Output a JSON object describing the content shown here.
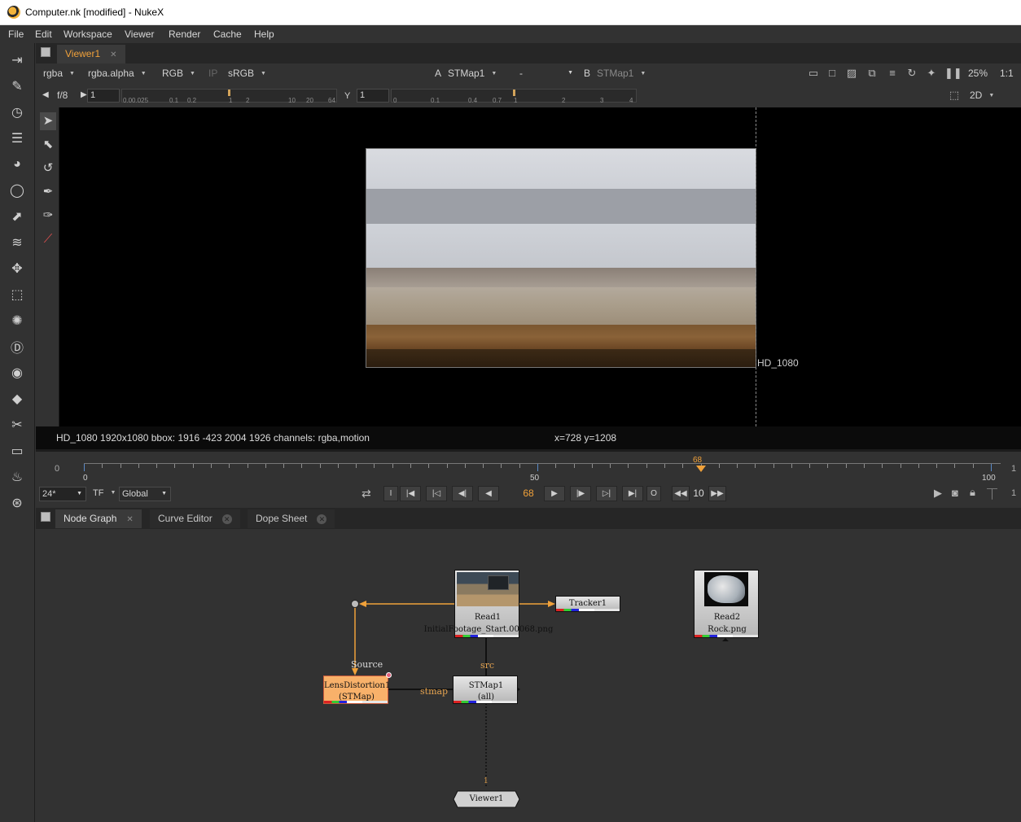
{
  "window": {
    "title": "Computer.nk [modified] - NukeX"
  },
  "menu": [
    "File",
    "Edit",
    "Workspace",
    "Viewer",
    "Render",
    "Cache",
    "Help"
  ],
  "viewer": {
    "tab": "Viewer1",
    "channels": "rgba",
    "alpha_channel": "rgba.alpha",
    "display_channels": "RGB",
    "ip": "IP",
    "lut": "sRGB",
    "input_a_label": "A",
    "input_a": "STMap1",
    "compare_mode": "-",
    "input_b_label": "B",
    "input_b": "STMap1",
    "zoom": "25%",
    "proxy": "1:1",
    "fstop": "f/8",
    "gain": "1",
    "gamma_label": "Y",
    "gamma": "1",
    "view_mode": "2D",
    "gain_ticks": [
      "0.0",
      "0.025",
      "0.1",
      "0.2",
      "1",
      "2",
      "10",
      "20",
      "64"
    ],
    "gamma_ticks": [
      "0",
      "0.1",
      "0.4",
      "0.7",
      "1",
      "2",
      "3",
      "4"
    ],
    "format_label": "HD_1080",
    "info_left": "HD_1080 1920x1080  bbox: 1916 -423 2004 1926 channels: rgba,motion",
    "info_coords": "x=728 y=1208"
  },
  "timeline": {
    "start": "0",
    "mid": "50",
    "end": "100",
    "current_frame_marker": "68",
    "right_overflow": "1",
    "fps": "24*",
    "timecode_mode": "TF",
    "range_mode": "Global",
    "frame_field": "68",
    "skip_increment": "10",
    "in_button": "I",
    "out_button": "O"
  },
  "node_panel": {
    "tabs": [
      "Node Graph",
      "Curve Editor",
      "Dope Sheet"
    ]
  },
  "nodes": {
    "read1": {
      "name": "Read1",
      "file": "InitialFootage_Start.00068.png"
    },
    "read2": {
      "name": "Read2",
      "file": "Rock.png"
    },
    "tracker1": {
      "name": "Tracker1"
    },
    "lens": {
      "name": "LensDistortion1",
      "sub": "(STMap)"
    },
    "stmap": {
      "name": "STMap1",
      "sub": "(all)"
    },
    "viewer1": {
      "name": "Viewer1"
    },
    "label_source": "Source",
    "label_src": "src",
    "label_stmap": "stmap",
    "label_viewer_input": "1"
  },
  "colors": {
    "accent": "#f0a13a",
    "node_selected": "#f8b16a",
    "viewer_bg": "#000000"
  },
  "icons": [
    "select-icon",
    "transform-icon",
    "rotate-icon",
    "pen-add-icon",
    "pen-remove-icon",
    "line-icon"
  ]
}
